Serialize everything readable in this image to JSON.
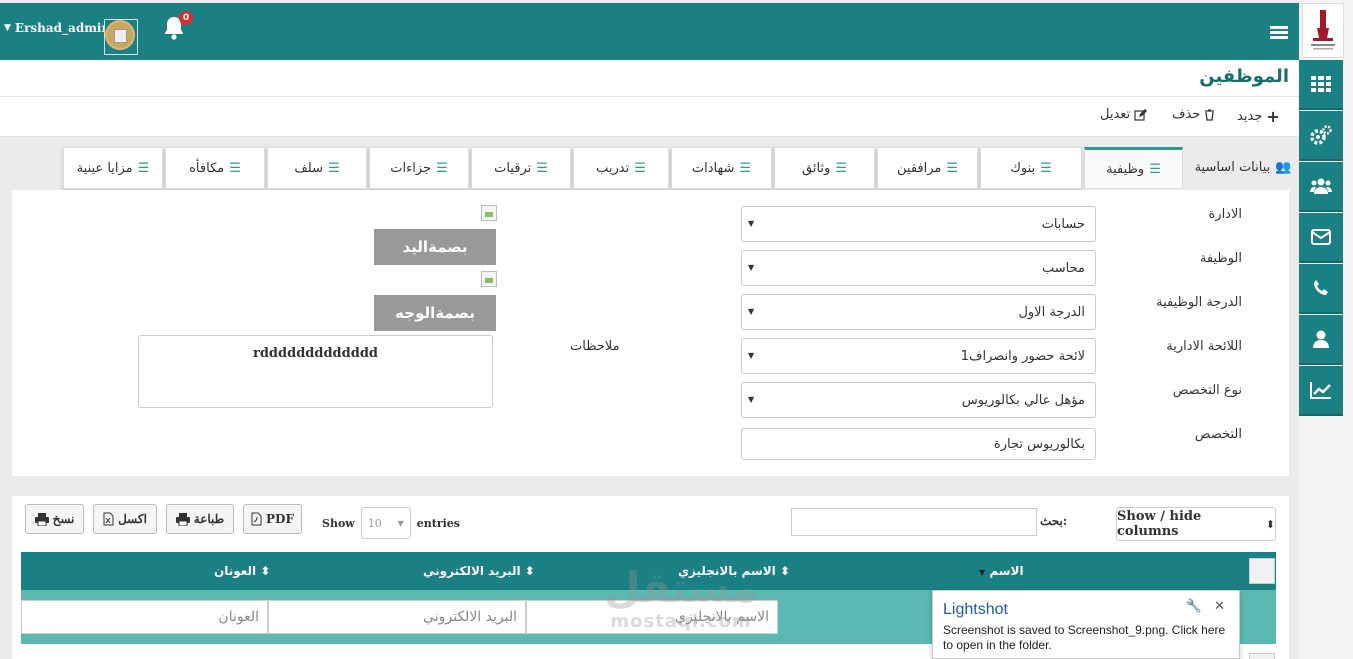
{
  "header": {
    "username": "Ershad_admin",
    "notification_count": "0"
  },
  "page": {
    "title": "الموظفين"
  },
  "toolbar": {
    "new_label": "جديد",
    "delete_label": "حذف",
    "edit_label": "تعديل"
  },
  "tabs": {
    "basic": "بيانات اساسية",
    "job": "وظيفية",
    "banks": "بنوك",
    "dependents": "مرافقين",
    "documents": "وثائق",
    "certificates": "شهادات",
    "training": "تدريب",
    "promotions": "ترقيات",
    "penalties": "جزاءات",
    "advances": "سلف",
    "rewards": "مكافأه",
    "in_kind": "مزايا عينية"
  },
  "form": {
    "department_label": "الادارة",
    "department_value": "حسابات",
    "job_label": "الوظيفة",
    "job_value": "محاسب",
    "grade_label": "الدرجة الوظيفية",
    "grade_value": "الدرجة الاول",
    "regulation_label": "اللائحة الادارية",
    "regulation_value": "لائحة حضور وانصراف1",
    "spec_type_label": "نوع التخصص",
    "spec_type_value": "مؤهل عالي بكالوريوس",
    "spec_label": "التخصص",
    "spec_value": "بكالوريوس تجارة",
    "handprint_button": "بصمةاليد",
    "faceprint_button": "بصمةالوجه",
    "notes_label": "ملاحظات",
    "notes_value": "rddddddddddddd"
  },
  "datatable": {
    "copy": "نسخ",
    "excel": "اكسل",
    "print": "طباعة",
    "pdf": "PDF",
    "show_label": "Show",
    "page_size": "10",
    "entries_label": "entries",
    "search_label": "بحث:",
    "colvis": "Show / hide columns",
    "columns": {
      "name": "الاسم",
      "name_en": "الاسم بالانجليزي",
      "email": "البريد الالكتروني",
      "address": "العونان"
    },
    "filters": {
      "name_en": "الاسم بالانجليزي",
      "email": "البريد الالكتروني",
      "address": "العونان"
    }
  },
  "watermark": {
    "arabic": "مستقل",
    "latin": "mostaql.com"
  },
  "toast": {
    "title": "Lightshot",
    "body": "Screenshot is saved to Screenshot_9.png. Click here to open in the folder."
  },
  "colors": {
    "primary": "#1a8083",
    "accent": "#5bb9b1",
    "danger": "#e02b2b"
  }
}
